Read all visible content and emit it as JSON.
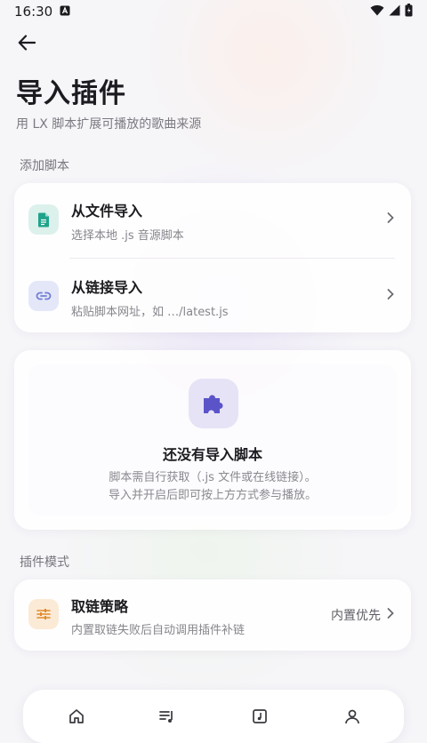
{
  "status_bar": {
    "time": "16:30",
    "notification_icon": "a-icon",
    "wifi_icon": "wifi-icon",
    "signal_icon": "signal-icon",
    "battery_icon": "battery-icon"
  },
  "header": {
    "back_icon": "arrow-left-icon",
    "title": "导入插件",
    "subtitle": "用 LX 脚本扩展可播放的歌曲来源"
  },
  "add_script": {
    "section_label": "添加脚本",
    "items": [
      {
        "title": "从文件导入",
        "subtitle": "选择本地 .js 音源脚本",
        "icon": "file-icon",
        "accent": "#1fa38a"
      },
      {
        "title": "从链接导入",
        "subtitle": "粘贴脚本网址，如 …/latest.js",
        "icon": "link-icon",
        "accent": "#6f7fd6"
      }
    ]
  },
  "empty_state": {
    "icon": "puzzle-icon",
    "title": "还没有导入脚本",
    "desc_line1": "脚本需自行获取（.js 文件或在线链接）。",
    "desc_line2": "导入并开启后即可按上方方式参与播放。"
  },
  "plugin_mode": {
    "section_label": "插件模式",
    "title": "取链策略",
    "subtitle": "内置取链失败后自动调用插件补链",
    "value": "内置优先",
    "icon": "sliders-icon",
    "accent": "#e08a2c"
  },
  "bottom_nav": {
    "items": [
      "home-icon",
      "queue-icon",
      "library-icon",
      "profile-icon"
    ]
  },
  "colors": {
    "background": "#f6f5f8",
    "accent_purple": "#5b54c9"
  }
}
